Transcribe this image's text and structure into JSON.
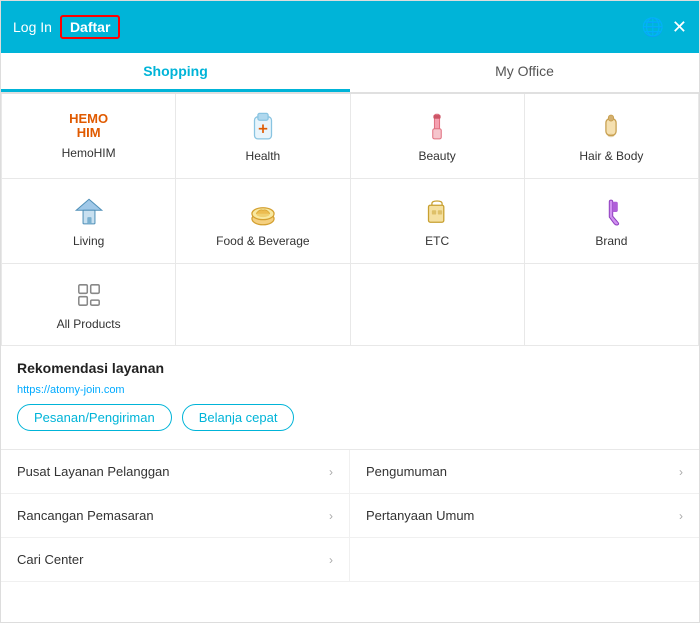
{
  "header": {
    "login_label": "Log In",
    "daftar_label": "Daftar",
    "globe_icon": "🌐",
    "close_icon": "✕"
  },
  "tabs": [
    {
      "label": "Shopping",
      "active": true
    },
    {
      "label": "My Office",
      "active": false
    }
  ],
  "categories": [
    {
      "id": "hemohim",
      "label": "HemoHIM",
      "type": "hemohim"
    },
    {
      "id": "health",
      "label": "Health",
      "type": "icon"
    },
    {
      "id": "beauty",
      "label": "Beauty",
      "type": "icon"
    },
    {
      "id": "hair-body",
      "label": "Hair & Body",
      "type": "icon"
    },
    {
      "id": "living",
      "label": "Living",
      "type": "icon"
    },
    {
      "id": "food-beverage",
      "label": "Food & Beverage",
      "type": "icon"
    },
    {
      "id": "etc",
      "label": "ETC",
      "type": "icon"
    },
    {
      "id": "brand",
      "label": "Brand",
      "type": "icon"
    }
  ],
  "all_products_label": "All Products",
  "recommendation": {
    "title": "Rekomendasi layanan",
    "watermark": "https://atomy-join.com",
    "buttons": [
      {
        "label": "Pesanan/Pengiriman"
      },
      {
        "label": "Belanja cepat"
      }
    ]
  },
  "menu_items": [
    {
      "label": "Pusat Layanan Pelanggan",
      "side": "left"
    },
    {
      "label": "Pengumuman",
      "side": "right"
    },
    {
      "label": "Rancangan Pemasaran",
      "side": "left"
    },
    {
      "label": "Pertanyaan Umum",
      "side": "right"
    },
    {
      "label": "Cari Center",
      "side": "left"
    },
    {
      "label": "",
      "side": "right"
    }
  ]
}
